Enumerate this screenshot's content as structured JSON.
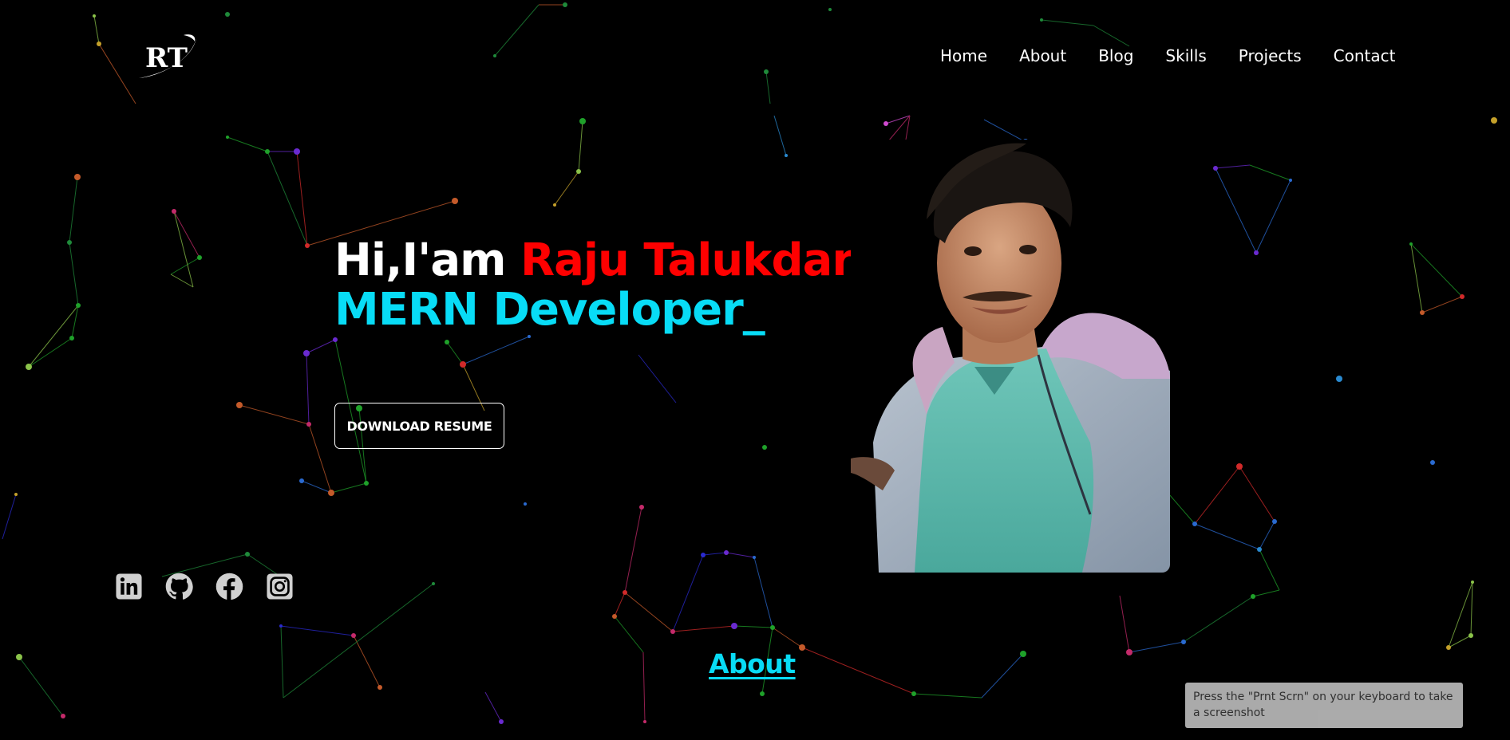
{
  "logo": {
    "text": "RT"
  },
  "nav": {
    "items": [
      "Home",
      "About",
      "Blog",
      "Skills",
      "Projects",
      "Contact"
    ]
  },
  "hero": {
    "greeting": "Hi,I'am ",
    "name": "Raju Talukdar_",
    "role": "MERN Developer_",
    "resume_label": "DOWNLOAD RESUME"
  },
  "social": {
    "icons": [
      "linkedin-icon",
      "github-icon",
      "facebook-icon",
      "instagram-icon"
    ]
  },
  "about": {
    "heading": "About"
  },
  "toast": {
    "text": "Press the \"Prnt Scrn\" on your keyboard to take a screenshot"
  },
  "colors": {
    "background": "#000000",
    "accent_red": "#ff0000",
    "accent_cyan": "#08dcf6",
    "text": "#ffffff",
    "icon": "#d0d0d0"
  }
}
